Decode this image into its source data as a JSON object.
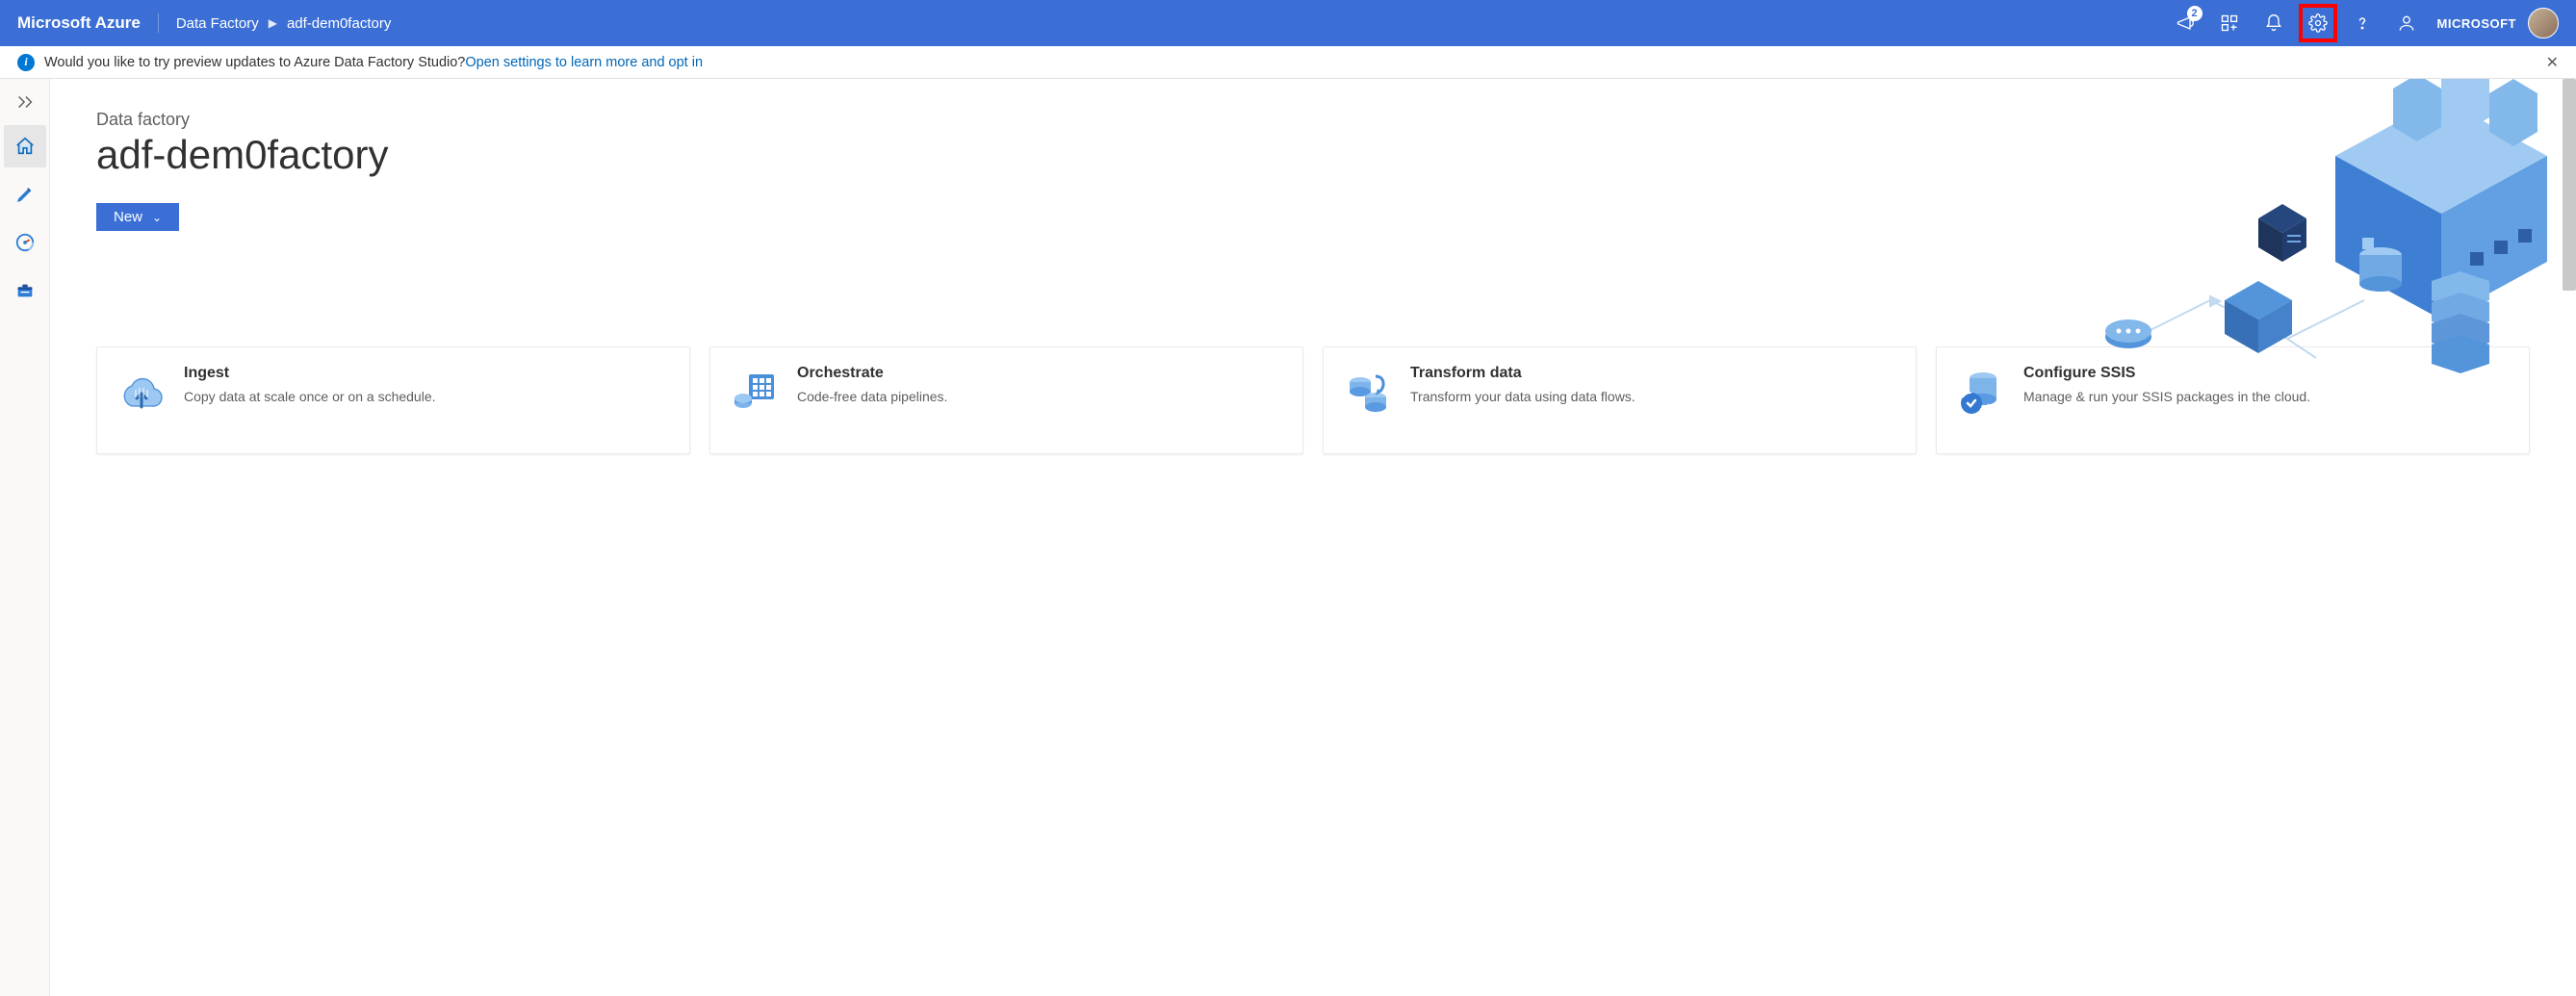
{
  "header": {
    "brand": "Microsoft Azure",
    "breadcrumb": [
      "Data Factory",
      "adf-dem0factory"
    ],
    "notification_badge": "2",
    "account_label": "MICROSOFT"
  },
  "banner": {
    "text": "Would you like to try preview updates to Azure Data Factory Studio? ",
    "link_text": "Open settings to learn more and opt in"
  },
  "sidebar": {
    "items": [
      {
        "name": "home",
        "active": true
      },
      {
        "name": "author",
        "active": false
      },
      {
        "name": "monitor",
        "active": false
      },
      {
        "name": "manage",
        "active": false
      }
    ]
  },
  "main": {
    "subtitle": "Data factory",
    "title": "adf-dem0factory",
    "new_button": "New"
  },
  "cards": [
    {
      "title": "Ingest",
      "desc": "Copy data at scale once or on a schedule.",
      "icon": "cloud-upload"
    },
    {
      "title": "Orchestrate",
      "desc": "Code-free data pipelines.",
      "icon": "pipeline"
    },
    {
      "title": "Transform data",
      "desc": "Transform your data using data flows.",
      "icon": "dataflow"
    },
    {
      "title": "Configure SSIS",
      "desc": "Manage & run your SSIS packages in the cloud.",
      "icon": "ssis"
    }
  ]
}
